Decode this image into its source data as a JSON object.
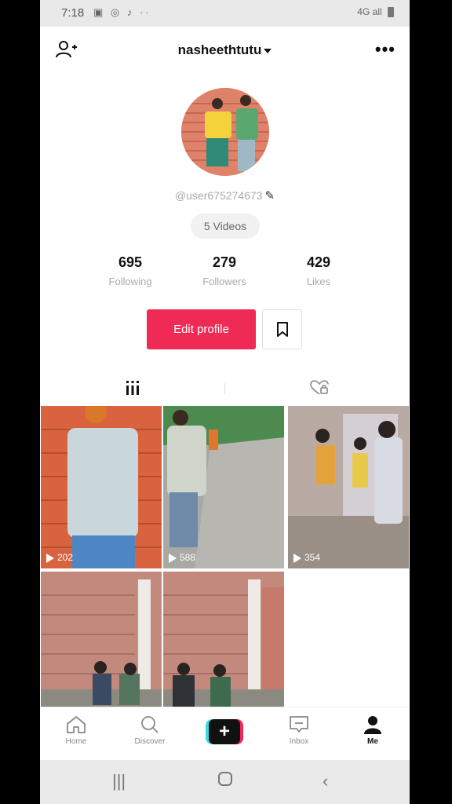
{
  "status_bar": {
    "time": "7:18",
    "notif_icons": "▣ ◎ ♪ ··",
    "network": "4G",
    "signal": "all"
  },
  "header": {
    "username": "nasheethtutu"
  },
  "profile": {
    "handle": "@user675274673",
    "videos_pill": "5 Videos"
  },
  "stats": [
    {
      "value": "695",
      "label": "Following"
    },
    {
      "value": "279",
      "label": "Followers"
    },
    {
      "value": "429",
      "label": "Likes"
    }
  ],
  "actions": {
    "edit_profile": "Edit profile"
  },
  "videos": [
    {
      "views": "202"
    },
    {
      "views": "588"
    },
    {
      "views": "354"
    },
    {
      "views": ""
    },
    {
      "views": ""
    }
  ],
  "bottom_nav": [
    {
      "label": "Home",
      "icon": "home-icon"
    },
    {
      "label": "Discover",
      "icon": "search-icon"
    },
    {
      "label": "",
      "icon": "plus-icon"
    },
    {
      "label": "Inbox",
      "icon": "inbox-icon"
    },
    {
      "label": "Me",
      "icon": "person-icon"
    }
  ],
  "colors": {
    "accent": "#ee2a55",
    "tiktok_cyan": "#3dd9e8",
    "tiktok_red": "#f0295a"
  }
}
